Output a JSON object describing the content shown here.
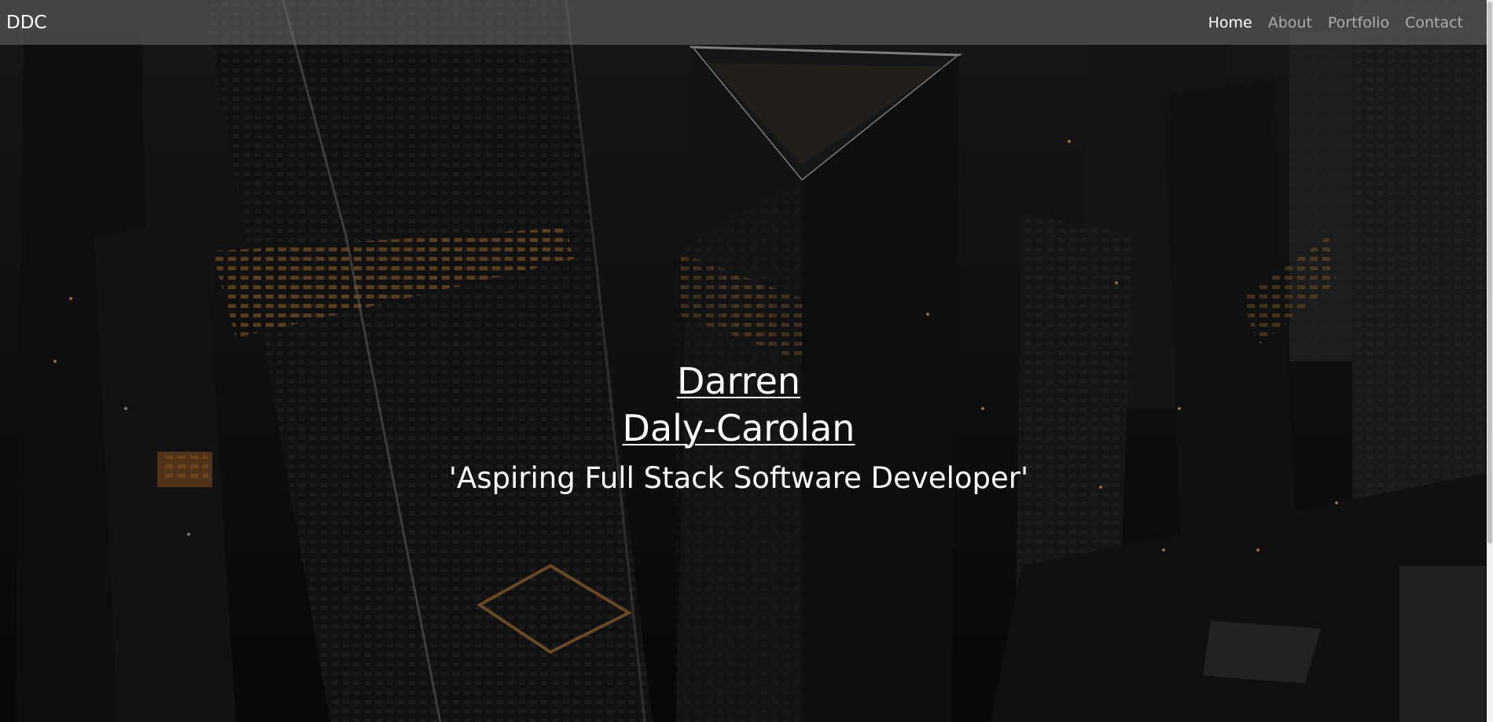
{
  "navbar": {
    "brand": "DDC",
    "links": [
      {
        "label": "Home",
        "active": true
      },
      {
        "label": "About",
        "active": false
      },
      {
        "label": "Portfolio",
        "active": false
      },
      {
        "label": "Contact",
        "active": false
      }
    ]
  },
  "hero": {
    "first_name": "Darren",
    "last_name": "Daly-Carolan",
    "tagline": "'Aspiring Full Stack Software Developer'"
  },
  "background": {
    "description_icon": "city-skyline-night-image"
  },
  "colors": {
    "navbar_bg": "#6e6e6e",
    "text_primary": "#ffffff",
    "link_muted": "#a8a8a8"
  }
}
